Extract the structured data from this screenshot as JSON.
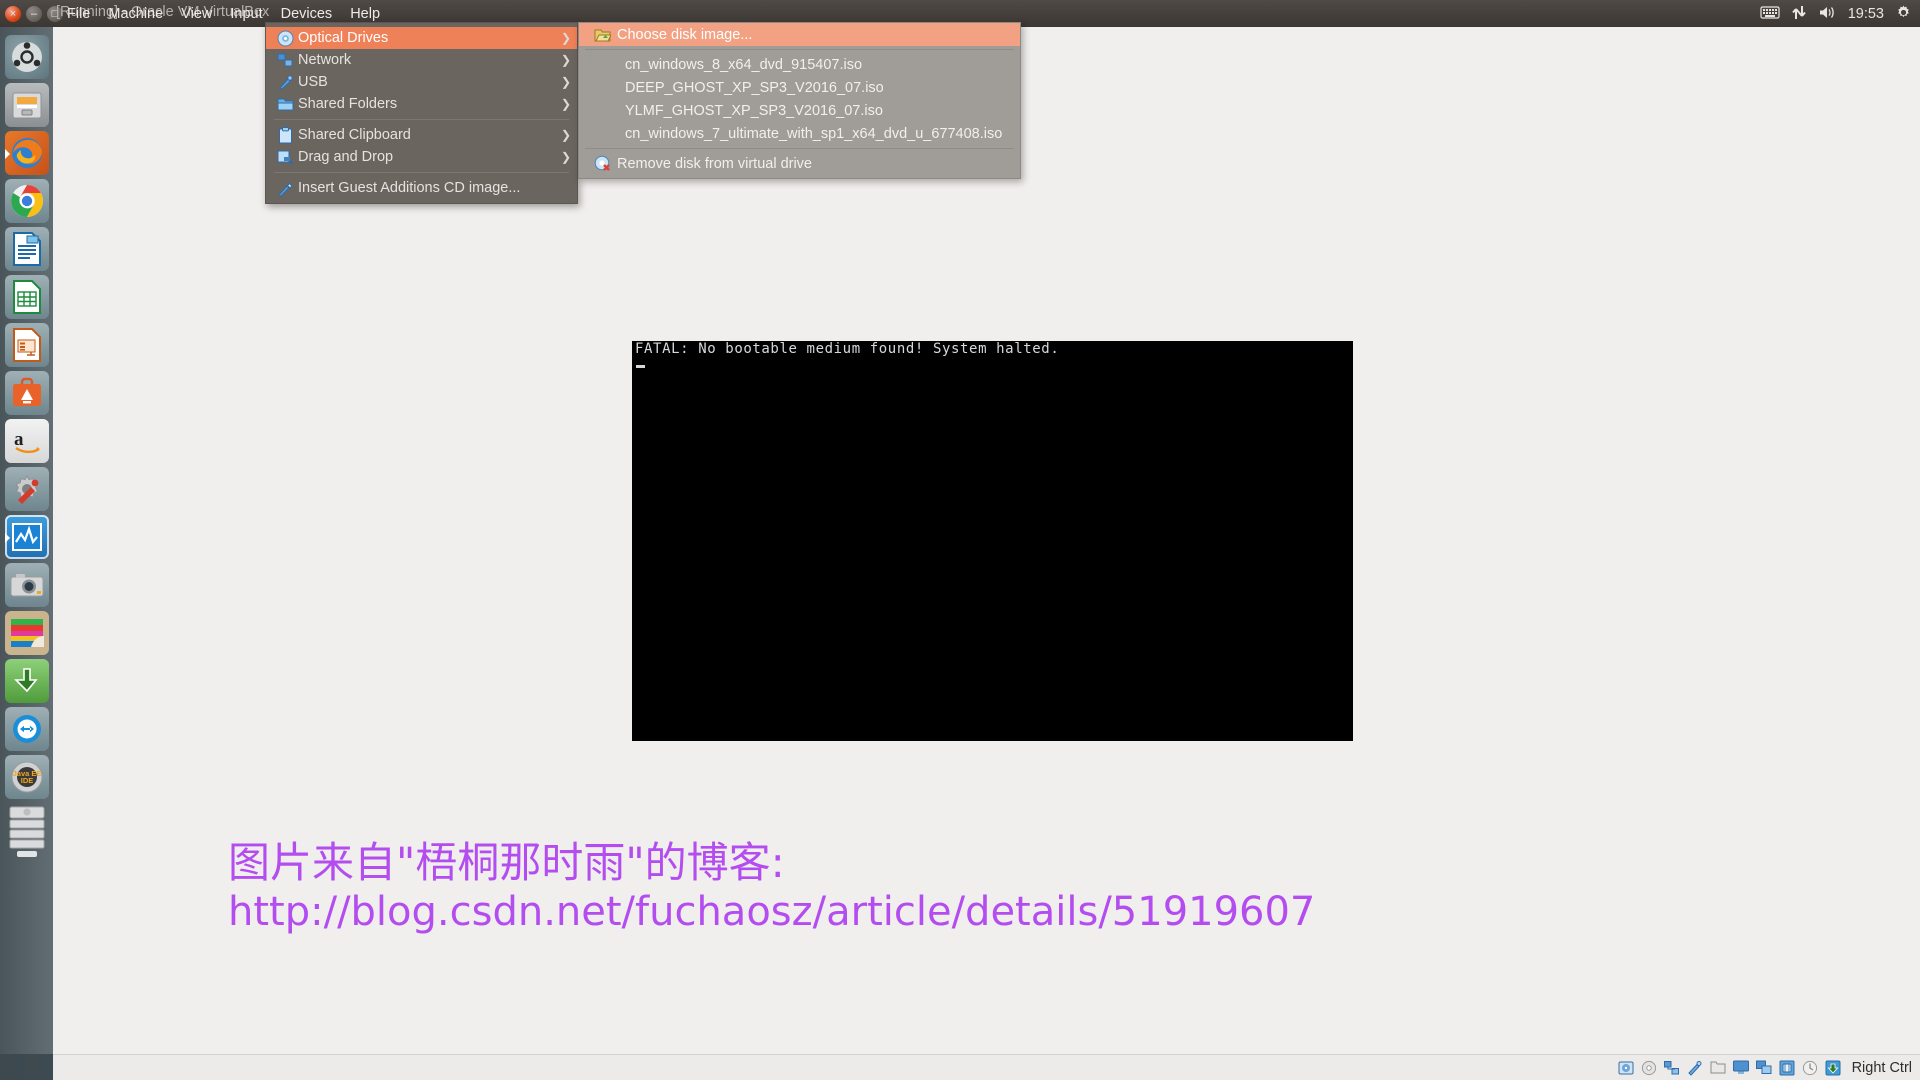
{
  "window": {
    "title": "[Running] - Oracle VM VirtualBox",
    "close_label": "×",
    "minimize_label": "–",
    "maximize_label": "□"
  },
  "menubar": {
    "items": [
      {
        "label": "File"
      },
      {
        "label": "Machine"
      },
      {
        "label": "View"
      },
      {
        "label": "Input"
      },
      {
        "label": "Devices"
      },
      {
        "label": "Help"
      }
    ]
  },
  "tray": {
    "keyboard_icon": "keyboard-icon",
    "network_icon": "network-icon",
    "volume_icon": "volume-icon",
    "clock": "19:53",
    "gear_icon": "gear-icon"
  },
  "launcher": {
    "items": [
      {
        "name": "ubuntu-dash",
        "label": "Ubuntu Dash"
      },
      {
        "name": "files",
        "label": "Files"
      },
      {
        "name": "firefox",
        "label": "Firefox"
      },
      {
        "name": "chrome",
        "label": "Google Chrome"
      },
      {
        "name": "libreoffice-writer",
        "label": "LibreOffice Writer"
      },
      {
        "name": "libreoffice-calc",
        "label": "LibreOffice Calc"
      },
      {
        "name": "libreoffice-impress",
        "label": "LibreOffice Impress"
      },
      {
        "name": "software-center",
        "label": "Ubuntu Software Center"
      },
      {
        "name": "amazon",
        "label": "Amazon"
      },
      {
        "name": "system-settings",
        "label": "System Settings"
      },
      {
        "name": "virtualbox",
        "label": "Oracle VM VirtualBox"
      },
      {
        "name": "cheese",
        "label": "Cheese Webcam"
      },
      {
        "name": "gimp",
        "label": "GIMP Image Editor"
      },
      {
        "name": "downloader",
        "label": "Downloader"
      },
      {
        "name": "teamviewer",
        "label": "TeamViewer"
      },
      {
        "name": "eclipse-javaee",
        "label": "Java EE IDE"
      },
      {
        "name": "disks",
        "label": "Disks"
      }
    ]
  },
  "devices_menu": {
    "items": [
      {
        "label": "Optical Drives",
        "icon": "optical-disc-icon",
        "submenu": true,
        "highlighted": true
      },
      {
        "label": "Network",
        "icon": "network-icon",
        "submenu": true,
        "highlighted": false
      },
      {
        "label": "USB",
        "icon": "usb-icon",
        "submenu": true,
        "highlighted": false
      },
      {
        "label": "Shared Folders",
        "icon": "folder-icon",
        "submenu": true,
        "highlighted": false
      },
      {
        "separator_after": true,
        "label": "Shared Clipboard",
        "icon": "clipboard-icon",
        "submenu": true,
        "highlighted": false
      },
      {
        "label": "Drag and Drop",
        "icon": "drag-drop-icon",
        "submenu": true,
        "highlighted": false
      },
      {
        "label": "Insert Guest Additions CD image...",
        "icon": "guest-additions-icon",
        "submenu": false,
        "highlighted": false
      }
    ]
  },
  "optical_menu": {
    "choose": {
      "label": "Choose disk image...",
      "icon": "open-folder-icon",
      "highlighted": true
    },
    "images": [
      {
        "label": "cn_windows_8_x64_dvd_915407.iso"
      },
      {
        "label": "DEEP_GHOST_XP_SP3_V2016_07.iso"
      },
      {
        "label": "YLMF_GHOST_XP_SP3_V2016_07.iso"
      },
      {
        "label": "cn_windows_7_ultimate_with_sp1_x64_dvd_u_677408.iso"
      }
    ],
    "remove": {
      "label": "Remove disk from virtual drive",
      "icon": "remove-disk-icon"
    }
  },
  "vm_console": {
    "line1": "FATAL: No bootable medium found! System halted.",
    "cursor": "_"
  },
  "watermark": {
    "line1": "图片来自\"梧桐那时雨\"的博客:",
    "line2": "http://blog.csdn.net/fuchaosz/article/details/51919607",
    "color": "#b44df0"
  },
  "status_bar": {
    "icons": [
      {
        "name": "hard-disk-icon"
      },
      {
        "name": "optical-disk-icon"
      },
      {
        "name": "network-adapter-icon"
      },
      {
        "name": "usb-icon"
      },
      {
        "name": "shared-folder-icon"
      },
      {
        "name": "display-icon"
      },
      {
        "name": "remote-desktop-icon"
      },
      {
        "name": "video-capture-icon"
      },
      {
        "name": "mouse-integration-icon"
      },
      {
        "name": "host-key-icon"
      }
    ],
    "host_key": "Right Ctrl"
  },
  "colors": {
    "panel": "#443e3a",
    "menu_bg": "#6b6560",
    "submenu_bg": "#a09c97",
    "highlight": "#ef8158",
    "highlight_light": "#f2a183",
    "desktop": "#f1efed"
  }
}
